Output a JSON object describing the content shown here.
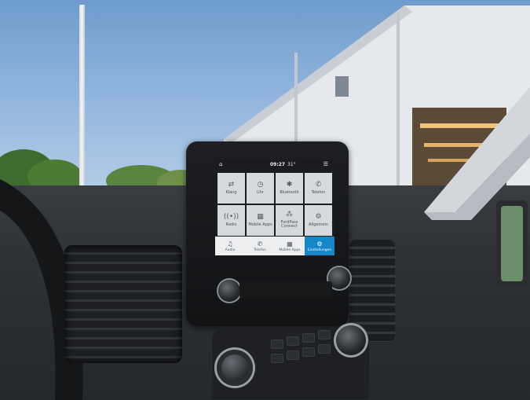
{
  "screen": {
    "status": {
      "home_icon": "home-icon",
      "time": "09:27",
      "temperature": "31°",
      "menu_icon": "menu-icon"
    },
    "tiles": [
      {
        "icon": "⇄",
        "label": "Klang"
      },
      {
        "icon": "◷",
        "label": "Uhr"
      },
      {
        "icon": "✱",
        "label": "Bluetooth"
      },
      {
        "icon": "✆",
        "label": "Telefon"
      },
      {
        "icon": "((•))",
        "label": "Radio"
      },
      {
        "icon": "▦",
        "label": "Mobile Apps"
      },
      {
        "icon": "⁂",
        "label": "FordPass Connect"
      },
      {
        "icon": "⚙",
        "label": "Allgemein"
      }
    ],
    "tabs": [
      {
        "icon": "♫",
        "label": "Audio"
      },
      {
        "icon": "✆",
        "label": "Telefon"
      },
      {
        "icon": "▦",
        "label": "Mobile Apps"
      },
      {
        "icon": "⚙",
        "label": "Einstellungen",
        "active": true
      }
    ]
  },
  "colors": {
    "accent": "#1587c8",
    "tile_bg": "#d6d9dd",
    "sky": "#8fb4dc"
  }
}
